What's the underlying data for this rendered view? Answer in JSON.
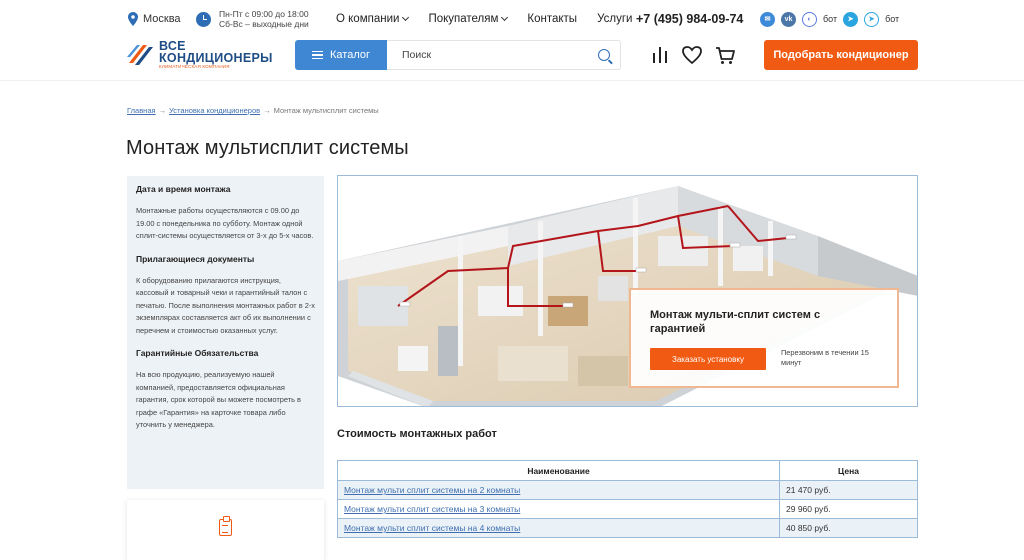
{
  "topbar": {
    "city": "Москва",
    "hours_line1": "Пн-Пт с 09:00 до 18:00",
    "hours_line2": "Сб-Вс – выходные дни",
    "nav": [
      {
        "label": "О компании",
        "dropdown": true
      },
      {
        "label": "Покупателям",
        "dropdown": true
      },
      {
        "label": "Контакты",
        "dropdown": false
      },
      {
        "label": "Услуги",
        "dropdown": false
      }
    ],
    "phone": "+7 (495) 984-09-74",
    "bot_label_1": "бот",
    "bot_label_2": "бот",
    "social_icons": [
      "mail-icon",
      "vk-icon",
      "max-icon",
      "telegram-icon",
      "telegram-bot-icon"
    ]
  },
  "header": {
    "logo_line1": "ВСЕ",
    "logo_line2": "КОНДИЦИОНЕРЫ",
    "logo_sub": "климатическая компания",
    "catalog_label": "Каталог",
    "search_placeholder": "Поиск",
    "cta_label": "Подобрать кондиционер",
    "colors": {
      "primary": "#3f86d3",
      "accent": "#f05a12",
      "logo_blue": "#1f4d86"
    }
  },
  "breadcrumbs": [
    {
      "label": "Главная",
      "link": true
    },
    {
      "label": "Установка кондиционеров",
      "link": true
    },
    {
      "label": "Монтаж мультисплит системы",
      "link": false
    }
  ],
  "breadcrumb_separator": "→",
  "page_title": "Монтаж мультисплит системы",
  "sidebar": {
    "sections": [
      {
        "heading": "Дата и время монтажа",
        "text": "Монтажные работы осуществляются с 09.00 до 19.00 с понедельника по субботу. Монтаж одной сплит-системы осуществляется от 3-х до 5-х часов."
      },
      {
        "heading": "Прилагающиеся документы",
        "text": "К оборудованию прилагаются инструкция, кассовый и товарный чеки и гарантийный талон с печатью. После выполнения монтажных работ в 2-х экземплярах составляется акт об их выполнении с перечнем и стоимостью оказанных услуг."
      },
      {
        "heading": "Гарантийные Обязательства",
        "text": "На всю продукцию, реализуемую нашей компанией, предоставляется официальная гарантия, срок которой вы можете посмотреть в графе «Гарантия» на карточке товара либо уточнить у менеджера."
      }
    ]
  },
  "hero": {
    "promo_title": "Монтаж мульти-сплит систем с гарантией",
    "promo_button": "Заказать установку",
    "promo_note": "Перезвоним в течении 15 минут"
  },
  "cost": {
    "title": "Стоимость монтажных работ",
    "columns": [
      "Наименование",
      "Цена"
    ],
    "rows": [
      {
        "name": "Монтаж мульти сплит системы на 2 комнаты",
        "price": "21 470 руб."
      },
      {
        "name": "Монтаж мульти сплит системы на 3 комнаты",
        "price": "29 960 руб."
      },
      {
        "name": "Монтаж мульти сплит системы на 4 комнаты",
        "price": "40 850 руб."
      }
    ]
  }
}
